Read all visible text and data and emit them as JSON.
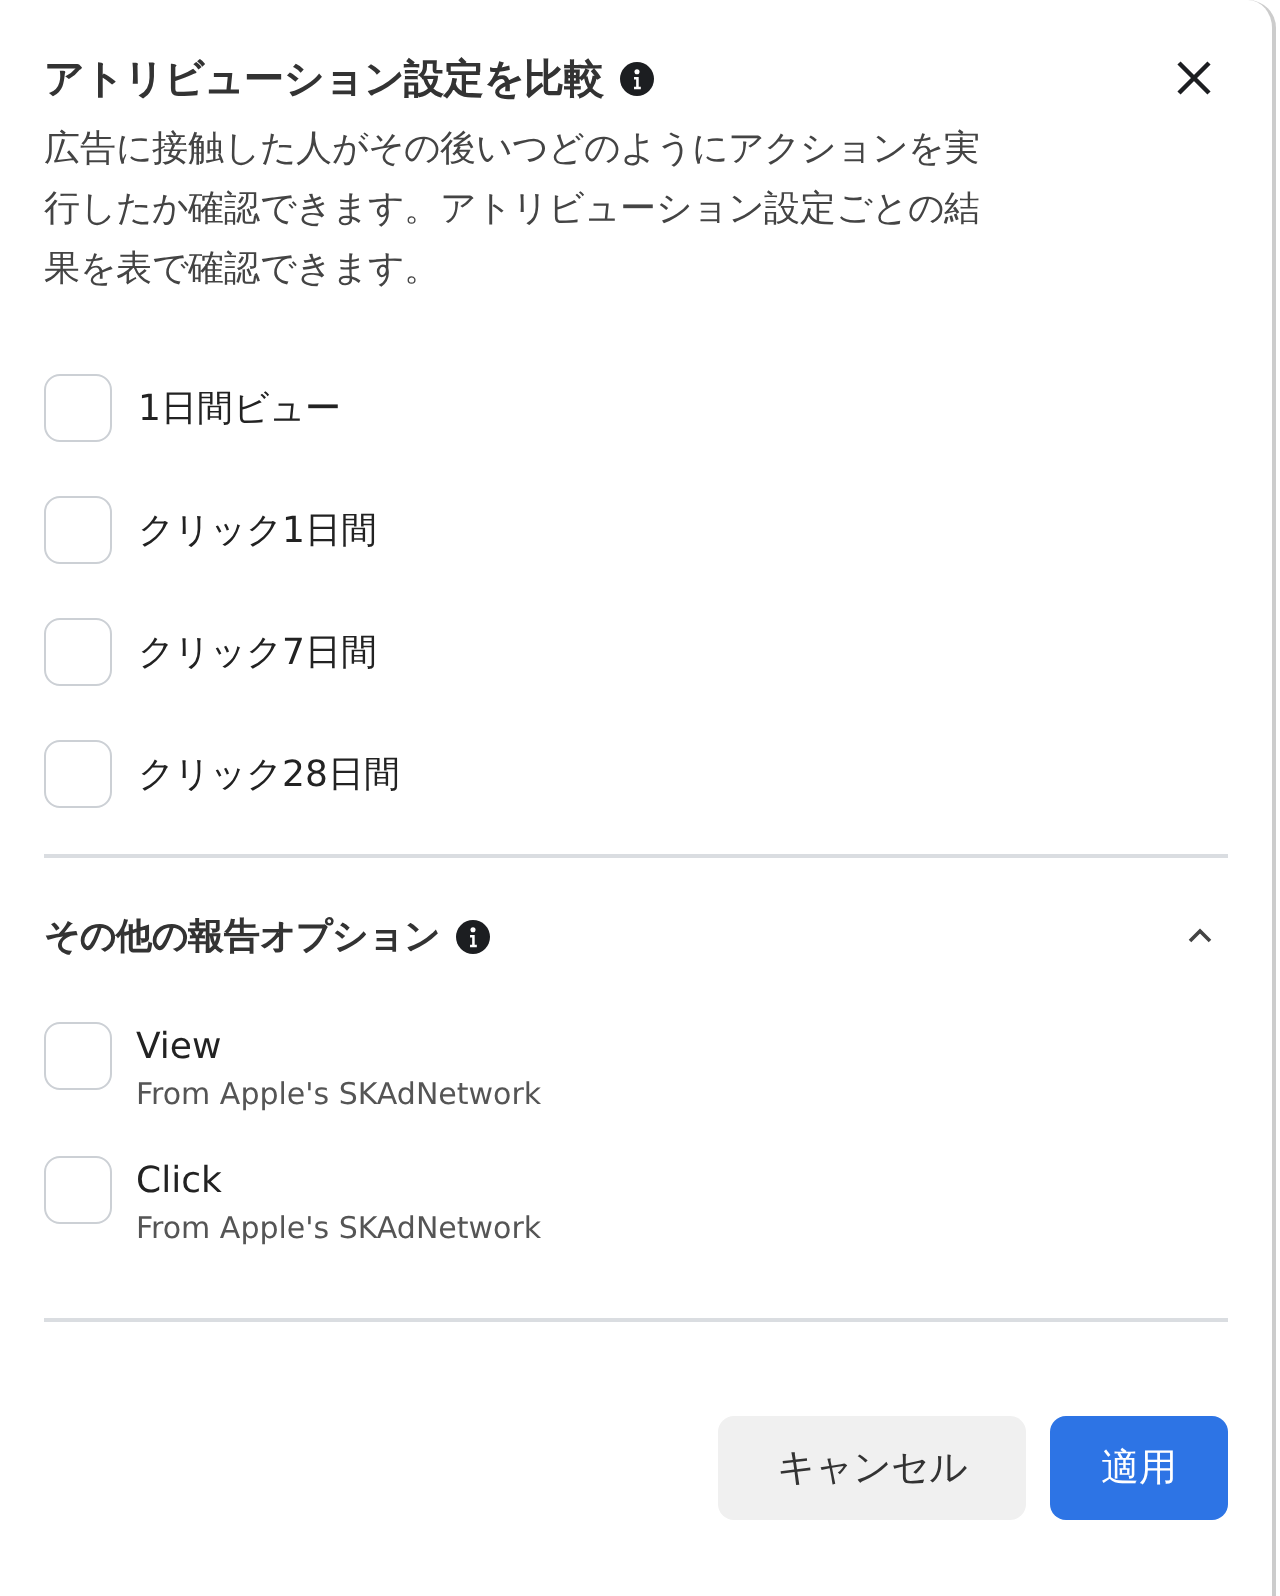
{
  "dialog": {
    "title": "アトリビューション設定を比較",
    "description": "広告に接触した人がその後いつどのようにアクションを実行したか確認できます。アトリビューション設定ごとの結果を表で確認できます。"
  },
  "windows": [
    {
      "label": "1日間ビュー",
      "checked": false
    },
    {
      "label": "クリック1日間",
      "checked": false
    },
    {
      "label": "クリック7日間",
      "checked": false
    },
    {
      "label": "クリック28日間",
      "checked": false
    }
  ],
  "other_options": {
    "title": "その他の報告オプション",
    "expanded": true,
    "items": [
      {
        "label": "View",
        "sublabel": "From Apple's SKAdNetwork",
        "checked": false
      },
      {
        "label": "Click",
        "sublabel": "From Apple's SKAdNetwork",
        "checked": false
      }
    ]
  },
  "buttons": [
    {
      "label": "キャンセル",
      "kind": "secondary"
    },
    {
      "label": "適用",
      "kind": "primary"
    }
  ]
}
